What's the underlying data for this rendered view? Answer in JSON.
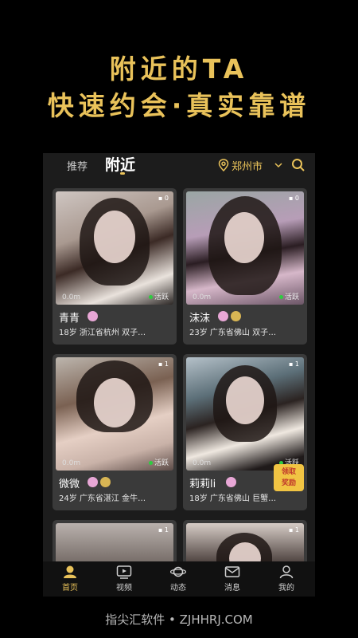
{
  "promo": {
    "line1": "附近的TA",
    "line2": "快速约会·真实靠谱"
  },
  "topbar": {
    "tab_recommend": "推荐",
    "tab_nearby": "附近",
    "city": "郑州市",
    "icons": [
      "location-icon",
      "chevron-down-icon",
      "search-icon"
    ]
  },
  "cards": [
    {
      "name": "青青",
      "info": "18岁  浙江省杭州  双子…",
      "distance": "0.0m",
      "active": "活跃",
      "camera": "0",
      "badges": [
        "pink"
      ]
    },
    {
      "name": "沫沫",
      "info": "23岁  广东省佛山  双子…",
      "distance": "0.0m",
      "active": "活跃",
      "camera": "0",
      "badges": [
        "pink",
        "gold"
      ]
    },
    {
      "name": "微微",
      "info": "24岁  广东省湛江  金牛…",
      "distance": "0.0m",
      "active": "活跃",
      "camera": "1",
      "badges": [
        "pink",
        "gold"
      ]
    },
    {
      "name": "莉莉li",
      "info": "18岁  广东省佛山  巨蟹…",
      "distance": "0.0m",
      "active": "活跃",
      "camera": "1",
      "badges": [
        "pink"
      ],
      "gift": "领取\n奖励"
    },
    {
      "camera": "1"
    },
    {
      "camera": "1"
    }
  ],
  "navbar": {
    "items": [
      {
        "label": "首页",
        "icon": "home-icon",
        "active": true
      },
      {
        "label": "视频",
        "icon": "video-icon",
        "active": false
      },
      {
        "label": "动态",
        "icon": "planet-icon",
        "active": false
      },
      {
        "label": "消息",
        "icon": "message-icon",
        "active": false
      },
      {
        "label": "我的",
        "icon": "profile-icon",
        "active": false
      }
    ]
  },
  "footer": "指尖汇软件 • ZJHHRJ.COM",
  "colors": {
    "accent": "#e9c25a",
    "background": "#000000",
    "card": "#3a3a3a",
    "active_dot": "#2ecc40"
  }
}
